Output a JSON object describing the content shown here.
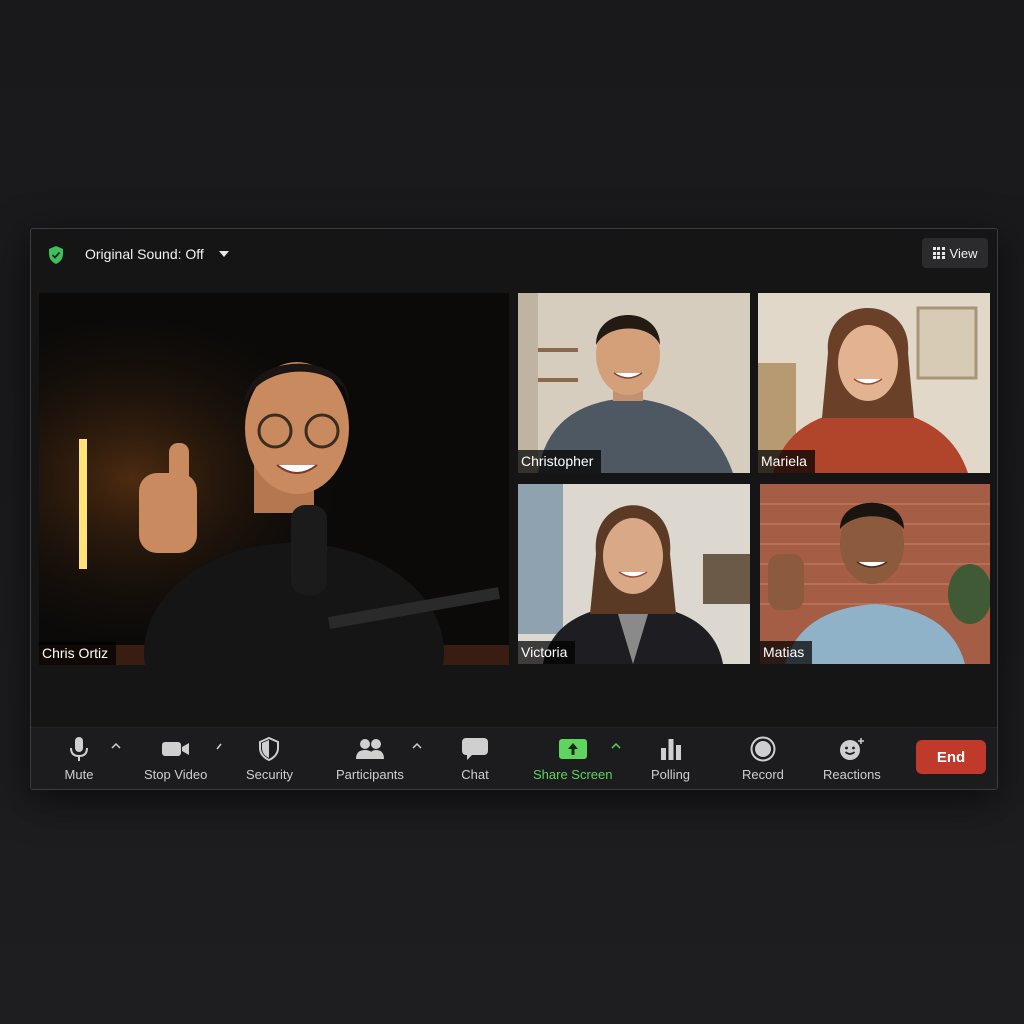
{
  "header": {
    "sound_label": "Original Sound: Off",
    "view_label": "View"
  },
  "participants": {
    "main": "Chris Ortiz",
    "tiles": [
      "Christopher",
      "Mariela",
      "Victoria",
      "Matias"
    ]
  },
  "toolbar": {
    "mute": "Mute",
    "stop_video": "Stop Video",
    "security": "Security",
    "participants": "Participants",
    "chat": "Chat",
    "share_screen": "Share Screen",
    "polling": "Polling",
    "record": "Record",
    "reactions": "Reactions",
    "end": "End"
  },
  "icons": {
    "encryption": "shield-check-icon",
    "view": "grid-icon",
    "mute": "microphone-icon",
    "video": "video-camera-icon",
    "security": "shield-icon",
    "participants": "people-icon",
    "chat": "speech-bubble-icon",
    "share": "share-screen-icon",
    "polling": "bar-chart-icon",
    "record": "record-icon",
    "reactions": "smiley-icon"
  },
  "colors": {
    "accent_green": "#5fd45f",
    "end_red": "#c0392b",
    "window_bg": "#151516"
  }
}
